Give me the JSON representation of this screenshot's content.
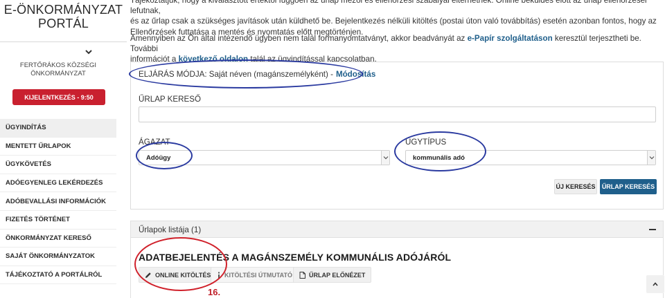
{
  "sidebar": {
    "logo_line1": "E-ÖNKORMÁNYZAT",
    "logo_line2": "PORTÁL",
    "org_line1": "FERTŐRÁKOS KÖZSÉGI",
    "org_line2": "ÖNKORMÁNYZAT",
    "logout_label": "KIJELENTKEZÉS - 9:50",
    "items": [
      {
        "label": "ÜGYINDÍTÁS",
        "active": true
      },
      {
        "label": "MENTETT ŰRLAPOK"
      },
      {
        "label": "ÜGYKÖVETÉS"
      },
      {
        "label": "ADÓEGYENLEG LEKÉRDEZÉS"
      },
      {
        "label": "ADÓBEVALLÁSI INFORMÁCIÓK"
      },
      {
        "label": "FIZETÉS TÖRTÉNET"
      },
      {
        "label": "ÖNKORMÁNYZAT KERESŐ"
      },
      {
        "label": "SAJÁT ÖNKORMÁNYZATOK"
      },
      {
        "label": "TÁJÉKOZTATÓ A PORTÁLRÓL"
      }
    ]
  },
  "intro": {
    "p1_line1": "Tájékoztatjuk, hogy a kiválasztott értéktől függően az űrlap mezői és ellenőrzési szabályai eltérhetnek. Online beküldés előtt az űrlap ellenőrzései lefutnak,",
    "p1_line2": "és az űrlap csak a szükséges javítások után küldhető be. Bejelentkezés nélküli kitöltés (postai úton való továbbítás) esetén azonban fontos, hogy az",
    "p1_line3": "Ellenőrzések futtatása a mentés és nyomtatás előtt megtörténjen.",
    "p2_a": "Amennyiben az Ön által intézendő ügyben nem talál formanyomtatványt, akkor beadványát az",
    "p2_link1": "e-Papír szolgáltatáson",
    "p2_b": "keresztül terjesztheti be. További",
    "p2_c": "információt a",
    "p2_link2": "következő oldalon",
    "p2_d": "talál az ügyindítással kapcsolatban."
  },
  "search": {
    "mode_text": "ELJÁRÁS MÓDJA: Saját néven (magánszemélyként) -",
    "mode_link": "Módosítás",
    "search_label": "ŰRLAP KERESŐ",
    "search_value": "",
    "sector_label": "ÁGAZAT",
    "sector_value": "Adóügy",
    "type_label": "ÜGYTÍPUS",
    "type_value": "kommunális adó",
    "new_search": "ÚJ KERESÉS",
    "do_search": "ŰRLAP KERESÉS"
  },
  "list": {
    "title": "Űrlapok listája (1)",
    "form_title": "ADATBEJELENTÉS A MAGÁNSZEMÉLY KOMMUNÁLIS ADÓJÁRÓL",
    "actions": {
      "online": "ONLINE KITÖLTÉS",
      "guide": "KITÖLTÉSI ÚTMUTATÓ",
      "preview": "ŰRLAP ELŐNÉZET"
    }
  },
  "annotations": {
    "step_number": "16.",
    "mode_color": "#2a3aa0",
    "online_color": "#d0202a"
  }
}
